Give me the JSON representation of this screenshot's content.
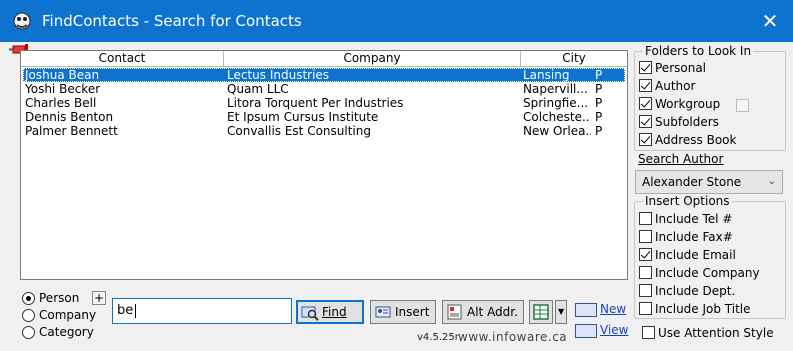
{
  "window": {
    "title": "FindContacts - Search for Contacts",
    "close_glyph": "✕"
  },
  "list": {
    "columns": [
      "Contact",
      "Company",
      "City"
    ],
    "rows": [
      {
        "contact": "Joshua Bean",
        "company": "Lectus Industries",
        "city": "Lansing",
        "flag": "P",
        "selected": true
      },
      {
        "contact": "Yoshi Becker",
        "company": "Quam LLC",
        "city": "Napervill...",
        "flag": "P",
        "selected": false
      },
      {
        "contact": "Charles Bell",
        "company": "Litora Torquent Per Industries",
        "city": "Springfie...",
        "flag": "P",
        "selected": false
      },
      {
        "contact": "Dennis Benton",
        "company": "Et Ipsum Cursus Institute",
        "city": "Colcheste...",
        "flag": "P",
        "selected": false
      },
      {
        "contact": "Palmer Bennett",
        "company": "Convallis Est Consulting",
        "city": "New Orlea...",
        "flag": "P",
        "selected": false
      }
    ]
  },
  "folders": {
    "legend": "Folders to Look In",
    "items": [
      {
        "label": "Personal",
        "checked": true
      },
      {
        "label": "Author",
        "checked": true
      },
      {
        "label": "Workgroup",
        "checked": true
      },
      {
        "label": "Subfolders",
        "checked": true
      },
      {
        "label": "Address Book",
        "checked": true
      }
    ],
    "workgroup_extra_checked": false
  },
  "search_author": {
    "label": "Search Author",
    "value": "Alexander Stone"
  },
  "insert_options": {
    "legend": "Insert Options",
    "items": [
      {
        "label": "Include Tel #",
        "checked": false
      },
      {
        "label": "Include Fax#",
        "checked": false
      },
      {
        "label": "Include Email",
        "checked": true
      },
      {
        "label": "Include Company",
        "checked": false
      },
      {
        "label": "Include Dept.",
        "checked": false
      },
      {
        "label": "Include Job Title",
        "checked": false
      }
    ]
  },
  "attention_style": {
    "label": "Use Attention Style",
    "checked": false
  },
  "search_mode": {
    "options": [
      {
        "label": "Person",
        "selected": true
      },
      {
        "label": "Company",
        "selected": false
      },
      {
        "label": "Category",
        "selected": false
      }
    ],
    "expand_glyph": "+"
  },
  "search": {
    "value": "be"
  },
  "buttons": {
    "find": "Find",
    "insert": "Insert",
    "alt_addr": "Alt Addr.",
    "new": "New",
    "view": "View"
  },
  "footer": {
    "version": "v4.5.25r",
    "website": "www.infoware.ca"
  },
  "colors": {
    "accent": "#0e73cf",
    "selection": "#0e73cf",
    "window_bg": "#f0f0f0"
  }
}
